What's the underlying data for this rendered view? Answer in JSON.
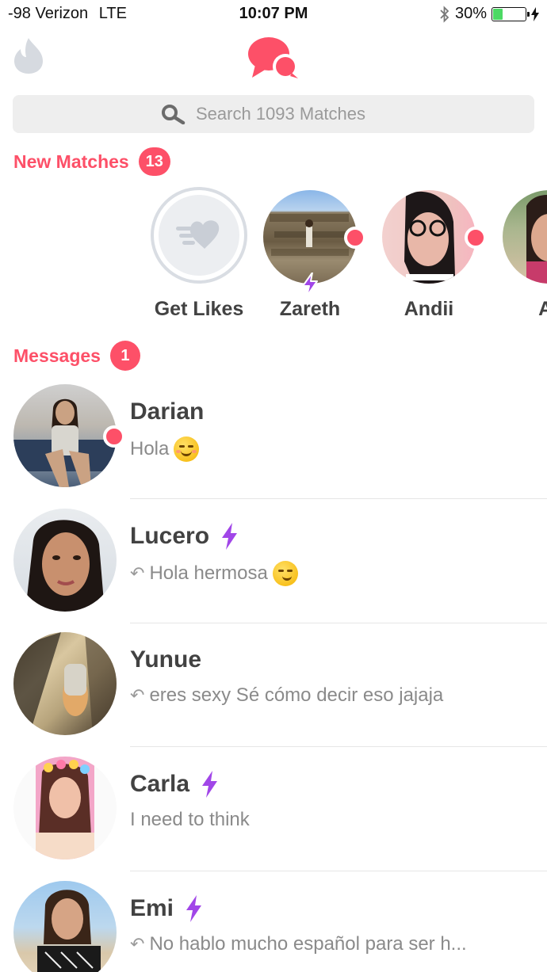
{
  "status_bar": {
    "carrier": "-98 Verizon",
    "network": "LTE",
    "time": "10:07 PM",
    "battery": "30%",
    "battery_level": 0.3
  },
  "search": {
    "placeholder": "Search 1093 Matches"
  },
  "new_matches": {
    "title": "New Matches",
    "count": "13",
    "items": [
      {
        "name": "Get Likes",
        "icon": "heart-wings-icon"
      },
      {
        "name": "Zareth",
        "unread": true,
        "super_like": true
      },
      {
        "name": "Andii",
        "unread": true
      },
      {
        "name": "Ar"
      }
    ]
  },
  "messages": {
    "title": "Messages",
    "count": "1",
    "items": [
      {
        "name": "Darian",
        "preview": "Hola",
        "emoji": "smiling-blush-emoji",
        "unread": true,
        "super_like": false,
        "replied": false
      },
      {
        "name": "Lucero",
        "preview": "Hola hermosa",
        "emoji": "smirk-emoji",
        "super_like": true,
        "replied": true
      },
      {
        "name": "Yunue",
        "preview": "eres sexy Sé cómo decir eso jajaja",
        "super_like": false,
        "replied": true
      },
      {
        "name": "Carla",
        "preview": "I need to think",
        "super_like": true,
        "replied": false
      },
      {
        "name": "Emi",
        "preview": "No hablo mucho español para ser h...",
        "super_like": true,
        "replied": true
      }
    ]
  },
  "colors": {
    "accent": "#fd5068",
    "super_like": "#a146e8",
    "text": "#424242",
    "muted": "#8a8a8a"
  }
}
